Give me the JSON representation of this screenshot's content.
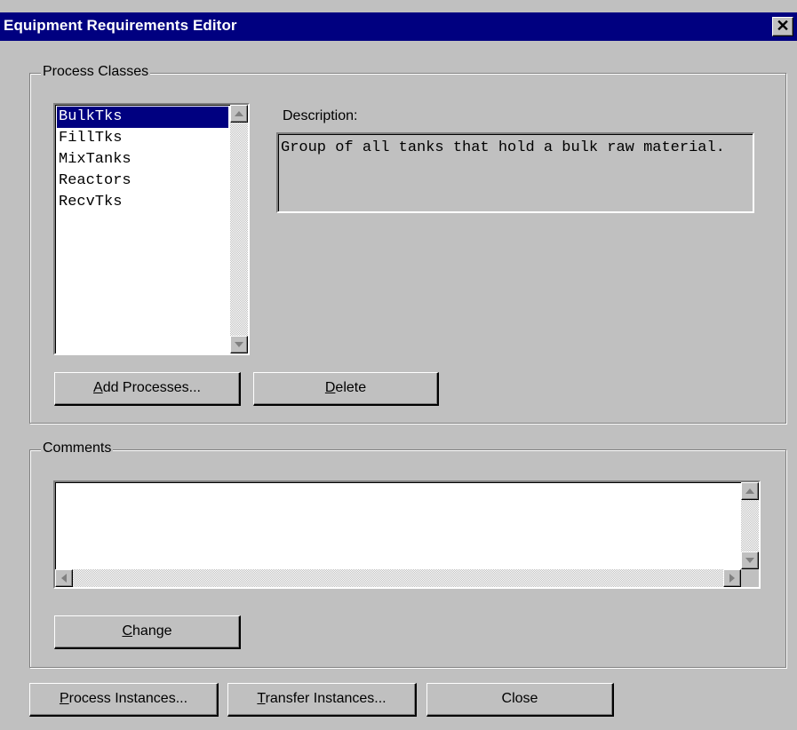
{
  "window": {
    "title": "Equipment Requirements Editor",
    "close_glyph": "✕"
  },
  "process_classes": {
    "group_label": "Process Classes",
    "list_items": [
      "BulkTks",
      "FillTks",
      "MixTanks",
      "Reactors",
      "RecvTks"
    ],
    "selected_item": "BulkTks",
    "description_label": "Description:",
    "description_text": "Group of all tanks that hold a bulk raw material.",
    "add_button": {
      "mnemonic": "A",
      "rest": "dd Processes..."
    },
    "delete_button": {
      "mnemonic": "D",
      "rest": "elete"
    }
  },
  "comments": {
    "group_label": "Comments",
    "text": "",
    "change_button": {
      "mnemonic": "C",
      "rest": "hange"
    }
  },
  "footer": {
    "process_instances_button": {
      "mnemonic": "P",
      "rest": "rocess Instances..."
    },
    "transfer_instances_button": {
      "mnemonic": "T",
      "rest": "ransfer Instances..."
    },
    "close_button": "Close"
  },
  "colors": {
    "titlebar": "#000080",
    "face": "#c0c0c0",
    "selection": "#000080"
  }
}
